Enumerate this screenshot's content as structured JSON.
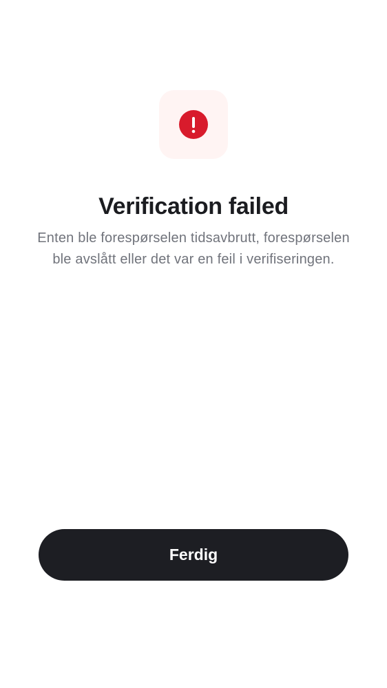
{
  "status": {
    "icon": "alert-circle-icon",
    "icon_color": "#d81b2c",
    "tile_color": "#fff4f3"
  },
  "title": "Verification failed",
  "message": "Enten ble forespørselen tidsavbrutt, forespørselen ble avslått eller det var en feil i verifiseringen.",
  "actions": {
    "done_label": "Ferdig"
  },
  "colors": {
    "background": "#ffffff",
    "title": "#1b1c20",
    "message": "#70737b",
    "button_background": "#1d1e23",
    "button_text": "#ffffff"
  }
}
